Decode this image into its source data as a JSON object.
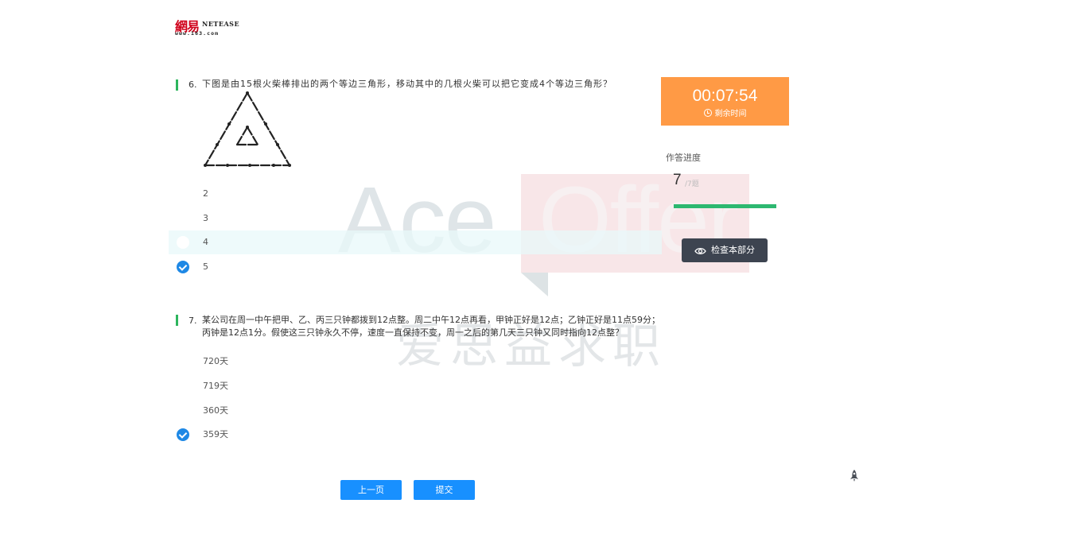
{
  "logo": {
    "cn_text": "網易",
    "en_text": "NETEASE",
    "url_text": "www.163.com",
    "brand_color": "#d0021b"
  },
  "watermark": {
    "latin_a": "Ace",
    "latin_b": "Offer",
    "cn_text": "爱思益求职"
  },
  "questions": [
    {
      "number": "6.",
      "text": "下图是由15根火柴棒排出的两个等边三角形，移动其中的几根火柴可以把它变成4个等边三角形？",
      "has_figure": true,
      "options": [
        {
          "label": "2",
          "selected": false,
          "highlighted": false
        },
        {
          "label": "3",
          "selected": false,
          "highlighted": false
        },
        {
          "label": "4",
          "selected": false,
          "highlighted": true
        },
        {
          "label": "5",
          "selected": true,
          "highlighted": false
        }
      ]
    },
    {
      "number": "7.",
      "text_line1": "某公司在周一中午把甲、乙、丙三只钟都拨到12点整。周二中午12点再看，甲钟正好是12点；乙钟正好是11点59分；",
      "text_line2": "丙钟是12点1分。假使这三只钟永久不停，速度一直保持不变，周一之后的第几天三只钟又同时指向12点整？",
      "options": [
        {
          "label": "720天",
          "selected": false
        },
        {
          "label": "719天",
          "selected": false
        },
        {
          "label": "360天",
          "selected": false
        },
        {
          "label": "359天",
          "selected": true
        }
      ]
    }
  ],
  "timer": {
    "time": "00:07:54",
    "label": "剩余时间",
    "icon": "clock-icon",
    "color": "#ff9a45"
  },
  "progress": {
    "title": "作答进度",
    "answered": "7",
    "total_text": "/7题",
    "fraction": 1.0,
    "color": "#2db870"
  },
  "check_button": {
    "label": "检查本部分",
    "icon": "eye-icon"
  },
  "nav": {
    "prev_label": "上一页",
    "submit_label": "提交",
    "accent": "#1890ff"
  },
  "rocket": {
    "icon": "rocket-icon"
  }
}
